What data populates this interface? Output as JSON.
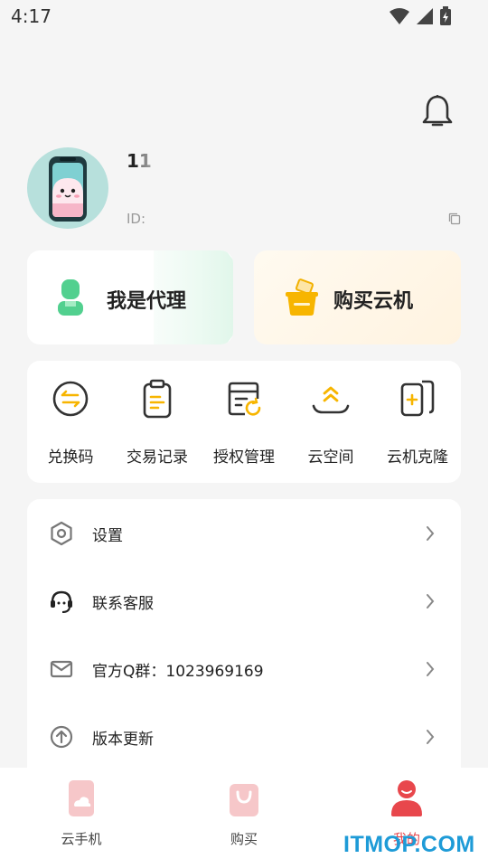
{
  "status_bar": {
    "time": "4:17"
  },
  "profile": {
    "username": "11",
    "user_id": "ID:"
  },
  "cards": {
    "agent_label": "我是代理",
    "buy_label": "购买云机"
  },
  "quick_actions": [
    {
      "label": "兑换码",
      "icon": "exchange-icon"
    },
    {
      "label": "交易记录",
      "icon": "clipboard-icon"
    },
    {
      "label": "授权管理",
      "icon": "authorization-icon"
    },
    {
      "label": "云空间",
      "icon": "cloud-space-icon"
    },
    {
      "label": "云机克隆",
      "icon": "clone-phone-icon"
    }
  ],
  "menu": [
    {
      "label": "设置",
      "icon": "settings-icon"
    },
    {
      "label": "联系客服",
      "icon": "headset-icon"
    },
    {
      "label": "官方Q群：1023969169",
      "icon": "mail-icon"
    },
    {
      "label": "版本更新",
      "icon": "update-icon"
    }
  ],
  "bottom_nav": [
    {
      "label": "云手机",
      "icon": "cloud-phone-icon",
      "active": false
    },
    {
      "label": "购买",
      "icon": "shopping-bag-icon",
      "active": false
    },
    {
      "label": "我的",
      "icon": "profile-icon",
      "active": true
    }
  ],
  "watermark": "ITMOP.COM",
  "colors": {
    "accent_red": "#e8474c",
    "agent_green": "#4fcf8a",
    "buy_orange": "#f7b500",
    "background": "#f5f5f5"
  }
}
